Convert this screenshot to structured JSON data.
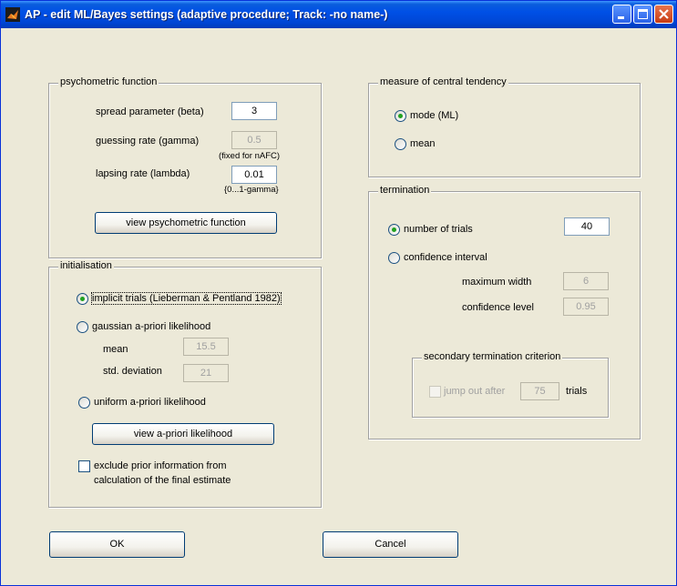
{
  "window": {
    "title": "AP - edit ML/Bayes settings (adaptive procedure; Track: -no name-)"
  },
  "psychometric": {
    "legend": "psychometric function",
    "beta_label": "spread parameter (beta)",
    "beta_value": "3",
    "gamma_label": "guessing rate (gamma)",
    "gamma_value": "0.5",
    "gamma_note": "(fixed for nAFC)",
    "lambda_label": "lapsing rate (lambda)",
    "lambda_value": "0.01",
    "lambda_note": "{0...1-gamma}",
    "view_button": "view psychometric function"
  },
  "initialisation": {
    "legend": "initialisation",
    "implicit_label": "implicit trials (Lieberman & Pentland 1982)",
    "gaussian_label": "gaussian a-priori likelihood",
    "mean_label": "mean",
    "mean_value": "15.5",
    "sd_label": "std. deviation",
    "sd_value": "21",
    "uniform_label": "uniform a-priori likelihood",
    "view_button": "view a-priori likelihood",
    "exclude_line1": "exclude prior information from",
    "exclude_line2": "calculation of the final estimate",
    "selected": "implicit"
  },
  "central": {
    "legend": "measure of central tendency",
    "mode_label": "mode (ML)",
    "mean_label": "mean",
    "selected": "mode"
  },
  "termination": {
    "legend": "termination",
    "trials_label": "number of trials",
    "trials_value": "40",
    "ci_label": "confidence interval",
    "max_width_label": "maximum width",
    "max_width_value": "6",
    "conf_level_label": "confidence level",
    "conf_level_value": "0.95",
    "selected": "trials",
    "secondary": {
      "legend": "secondary termination criterion",
      "jump_label": "jump out after",
      "jump_value": "75",
      "trials_unit": "trials"
    }
  },
  "buttons": {
    "ok": "OK",
    "cancel": "Cancel"
  },
  "colors": {
    "titlebar": "#0050e6",
    "face": "#ece9d8",
    "radio_dot": "#21a121"
  }
}
